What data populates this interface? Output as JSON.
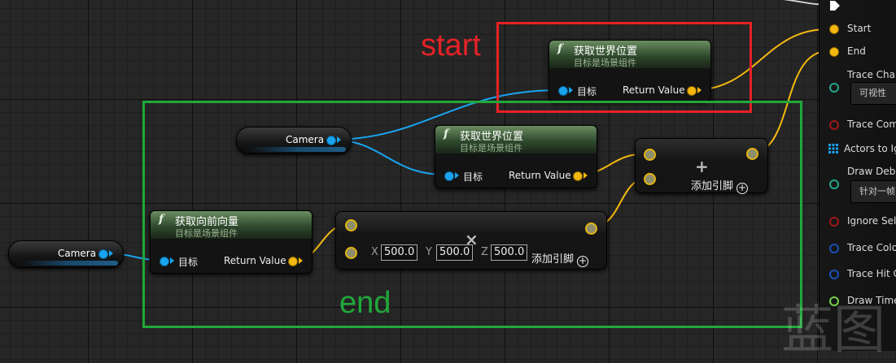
{
  "annotations": {
    "start_label": "start",
    "end_label": "end",
    "start_color": "#e52226",
    "end_color": "#1fa83a"
  },
  "nodes": {
    "get_world_location_top": {
      "func_icon": "f",
      "title": "获取世界位置",
      "subtitle": "目标是场景组件",
      "input_label": "目标",
      "output_label": "Return Value"
    },
    "get_world_location_mid": {
      "func_icon": "f",
      "title": "获取世界位置",
      "subtitle": "目标是场景组件",
      "input_label": "目标",
      "output_label": "Return Value"
    },
    "get_forward_vector": {
      "func_icon": "f",
      "title": "获取向前向量",
      "subtitle": "目标是场景组件",
      "input_label": "目标",
      "output_label": "Return Value"
    },
    "camera_var_top": {
      "label": "Camera"
    },
    "camera_var_bottom": {
      "label": "Camera"
    },
    "multiply_node": {
      "x_label": "X",
      "x_value": "500.0",
      "y_label": "Y",
      "y_value": "500.0",
      "z_label": "Z",
      "z_value": "500.0",
      "add_pin_label": "添加引脚",
      "operator_glyph": "×"
    },
    "add_node": {
      "add_pin_label": "添加引脚",
      "operator_glyph": "+"
    }
  },
  "panel": {
    "items": [
      {
        "label": "Start",
        "pin": "yellow"
      },
      {
        "label": "End",
        "pin": "yellow"
      },
      {
        "label": "Trace Channel",
        "dropdown": "可视性",
        "pin": "teal"
      },
      {
        "label": "Trace Complex",
        "pin": "red"
      },
      {
        "label": "Actors to Ignore",
        "pin": "grid"
      },
      {
        "label": "Draw Debug Type",
        "dropdown": "针对一帧",
        "pin": "teal"
      },
      {
        "label": "Ignore Self",
        "pin": "red"
      },
      {
        "label": "Trace Color",
        "pin": "blue"
      },
      {
        "label": "Trace Hit Color",
        "pin": "blue"
      },
      {
        "label": "Draw Time",
        "pin": "green"
      }
    ]
  },
  "watermark": "蓝图"
}
